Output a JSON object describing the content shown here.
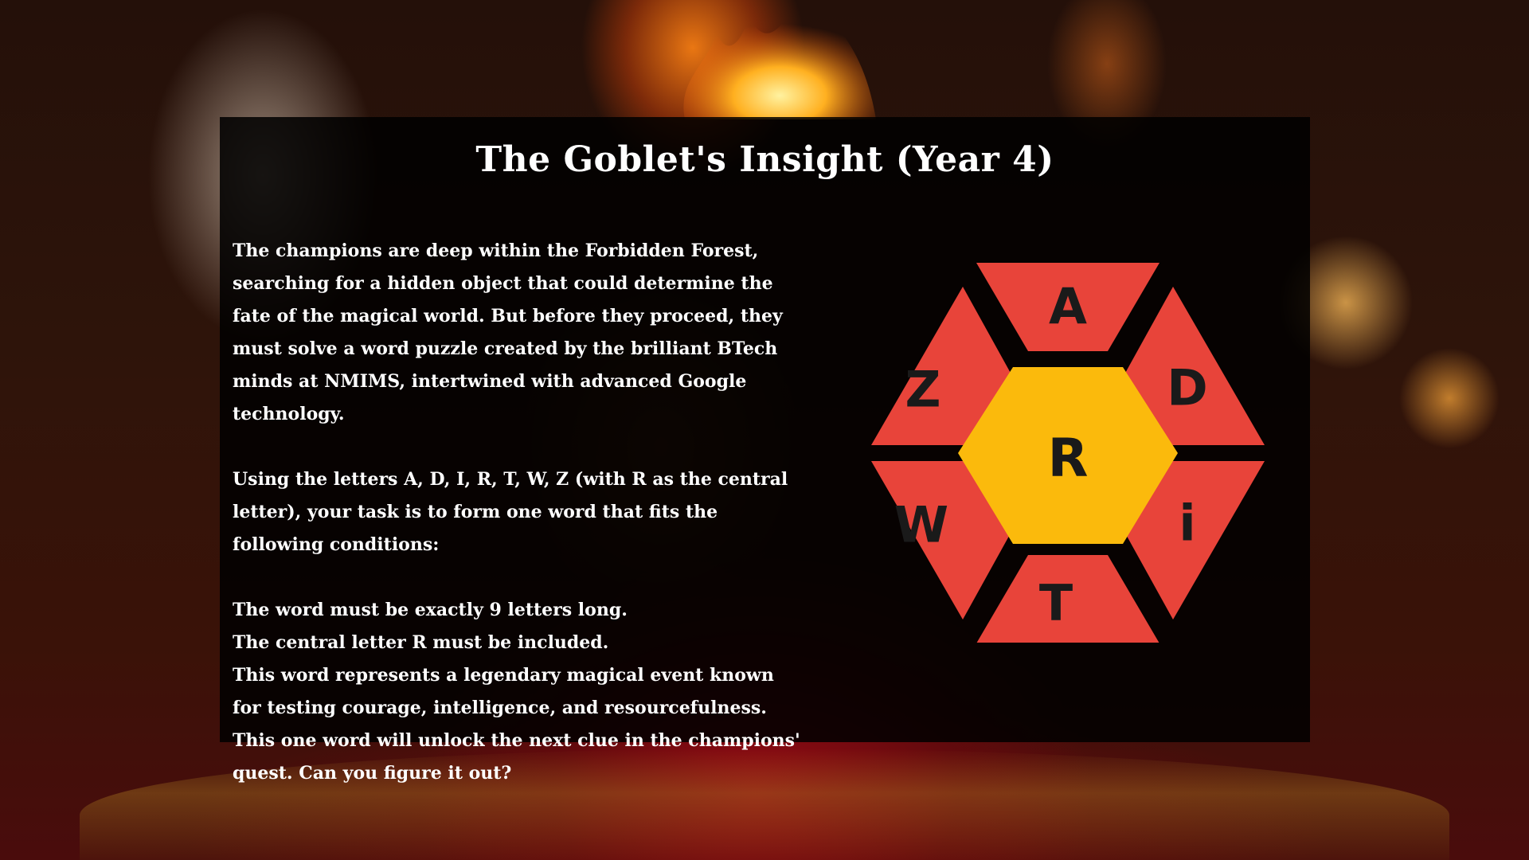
{
  "puzzle": {
    "title": "The Goblet's Insight (Year 4)",
    "intro": "The champions are deep within the Forbidden Forest, searching for a hidden object that could determine the fate of the magical world. But before they proceed, they must solve a word puzzle created by the brilliant BTech minds at NMIMS, intertwined with advanced Google technology.",
    "instructions": "Using the letters A, D, I, R, T, W, Z (with R as the central letter), your task is to form one word that fits the following conditions:",
    "conditions": [
      "The word must be exactly 9 letters long.",
      "The central letter R must be included.",
      "This word represents a legendary magical event known for testing courage, intelligence, and resourcefulness.",
      "This one word will unlock the next clue in the champions' quest. Can you figure it out?"
    ]
  },
  "hexagon": {
    "center_letter": "R",
    "outer_letters": {
      "top": "A",
      "upper_right": "D",
      "lower_right": "i",
      "bottom": "T",
      "lower_left": "W",
      "upper_left": "Z"
    },
    "center_color": "#FBBA0C",
    "outer_color": "#E8443A"
  }
}
